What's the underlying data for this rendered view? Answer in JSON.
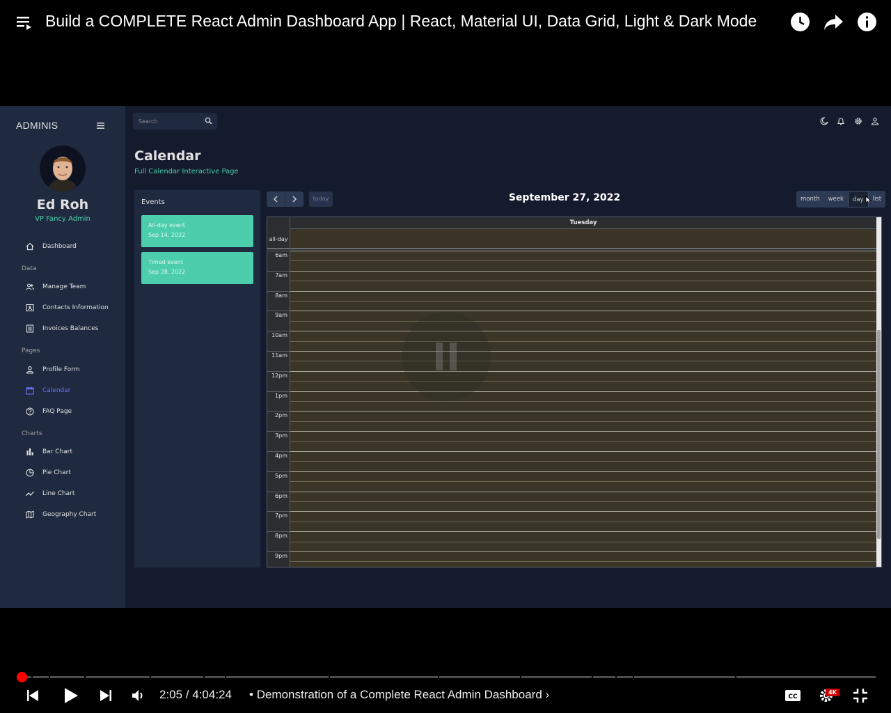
{
  "player": {
    "video_title": "Build a COMPLETE React Admin Dashboard App | React, Material UI, Data Grid, Light & Dark Mode",
    "current_time": "2:05",
    "duration": "4:04:24",
    "time_display": "2:05 / 4:04:24",
    "chapter_separator": "•",
    "chapter": "Demonstration of a Complete React Admin Dashboard",
    "progress_fraction": 0.0086,
    "quality_badge": "4K",
    "accent_color": "#ff0000",
    "icons": [
      "playlist-icon",
      "watch-later-icon",
      "share-icon",
      "info-icon",
      "previous-icon",
      "play-icon",
      "next-icon",
      "volume-icon",
      "captions-icon",
      "settings-icon",
      "exit-fullscreen-icon"
    ]
  },
  "app": {
    "brand": "ADMINIS",
    "user": {
      "name": "Ed Roh",
      "role": "VP Fancy Admin"
    },
    "search": {
      "placeholder": "Search"
    },
    "sidebar": {
      "dashboard": "Dashboard",
      "sections": {
        "data": "Data",
        "pages": "Pages",
        "charts": "Charts"
      },
      "items": {
        "team": "Manage Team",
        "contacts": "Contacts Information",
        "invoices": "Invoices Balances",
        "profile": "Profile Form",
        "calendar": "Calendar",
        "faq": "FAQ Page",
        "bar": "Bar Chart",
        "pie": "Pie Chart",
        "line": "Line Chart",
        "geo": "Geography Chart"
      },
      "active_item": "Calendar",
      "active_color": "#6870fa"
    },
    "page": {
      "title": "Calendar",
      "subtitle": "Full Calendar Interactive Page"
    },
    "events": {
      "title": "Events",
      "items": [
        {
          "title": "All-day event",
          "date": "Sep 14, 2022"
        },
        {
          "title": "Timed event",
          "date": "Sep 28, 2022"
        }
      ],
      "card_color": "#4cceac"
    },
    "calendar": {
      "today_label": "today",
      "current_date": "September 27, 2022",
      "views": {
        "month": "month",
        "week": "week",
        "day": "day",
        "list": "list"
      },
      "active_view": "day",
      "day_header": "Tuesday",
      "allday_label": "all-day",
      "hours": [
        "6am",
        "7am",
        "8am",
        "9am",
        "10am",
        "11am",
        "12pm",
        "1pm",
        "2pm",
        "3pm",
        "4pm",
        "5pm",
        "6pm",
        "7pm",
        "8pm",
        "9pm"
      ]
    },
    "colors": {
      "background": "#141b2d",
      "panel": "#1f2a40",
      "accent_green": "#4cceac",
      "today_highlight": "#3a3526"
    }
  }
}
